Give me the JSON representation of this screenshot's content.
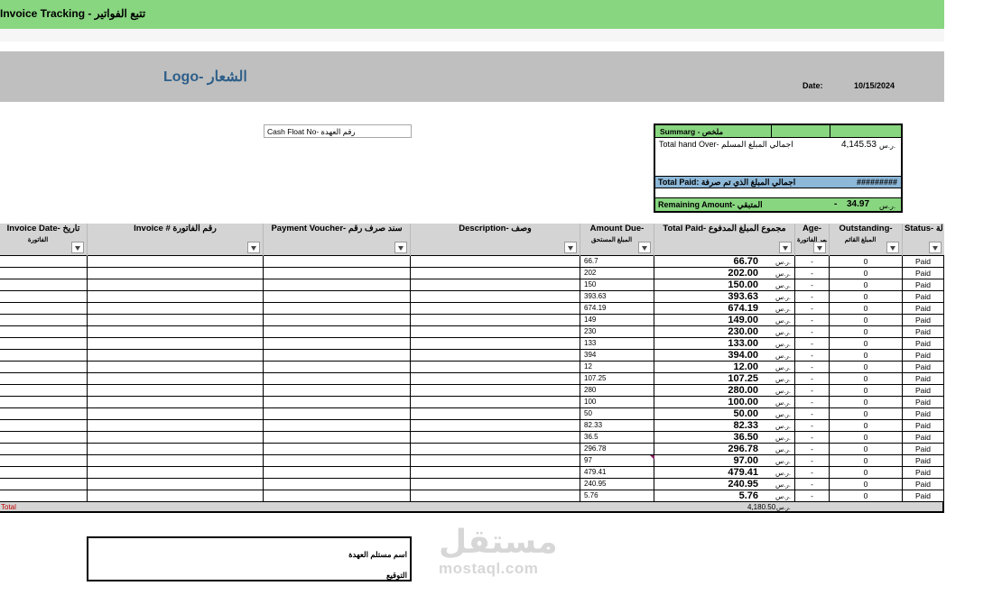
{
  "title": "Invoice Tracking - تتبع الفواتير",
  "logo": "Logo- الشعار",
  "date": {
    "label": "Date:",
    "value": "10/15/2024"
  },
  "cash_float": "Cash Float No- رقم العهدة",
  "summary": {
    "header": "Summarg - ملخص",
    "total_handover_label": "Total hand Over- اجمالي المبلغ المسلم",
    "total_handover_value": "4,145.53",
    "total_handover_currency": "ر.س.",
    "total_paid_label": "Total Paid: اجمالي المبلغ الذي تم صرفة",
    "total_paid_value": "#########",
    "remaining_label": "Remaining Amount- المتبقي",
    "remaining_sign": "-",
    "remaining_value": "34.97",
    "remaining_currency": "ر.س."
  },
  "columns": [
    {
      "title": "Invoice Date- تاريخ",
      "sub": "الفاتورة"
    },
    {
      "title": "Invoice # رقم الفاتورة",
      "sub": ""
    },
    {
      "title": "Payment Voucher- سند صرف رقم",
      "sub": ""
    },
    {
      "title": "Description- وصف",
      "sub": ""
    },
    {
      "title": "Amount Due-",
      "sub": "المبلغ المستحق"
    },
    {
      "title": "Total Paid- مجموع المبلغ المدفوع",
      "sub": ""
    },
    {
      "title": "Age-",
      "sub": "عمر الفاتورة"
    },
    {
      "title": "Outstanding-",
      "sub": "المبلغ القائم"
    },
    {
      "title": "Status- الحالة",
      "sub": ""
    }
  ],
  "currency": "ر.س.",
  "rows": [
    {
      "due": "66.7",
      "paid": "66.70",
      "age": "-",
      "outstanding": "0",
      "status": "Paid"
    },
    {
      "due": "202",
      "paid": "202.00",
      "age": "-",
      "outstanding": "0",
      "status": "Paid"
    },
    {
      "due": "150",
      "paid": "150.00",
      "age": "-",
      "outstanding": "0",
      "status": "Paid"
    },
    {
      "due": "393.63",
      "paid": "393.63",
      "age": "-",
      "outstanding": "0",
      "status": "Paid"
    },
    {
      "due": "674.19",
      "paid": "674.19",
      "age": "-",
      "outstanding": "0",
      "status": "Paid"
    },
    {
      "due": "149",
      "paid": "149.00",
      "age": "-",
      "outstanding": "0",
      "status": "Paid"
    },
    {
      "due": "230",
      "paid": "230.00",
      "age": "-",
      "outstanding": "0",
      "status": "Paid"
    },
    {
      "due": "133",
      "paid": "133.00",
      "age": "-",
      "outstanding": "0",
      "status": "Paid"
    },
    {
      "due": "394",
      "paid": "394.00",
      "age": "-",
      "outstanding": "0",
      "status": "Paid"
    },
    {
      "due": "12",
      "paid": "12.00",
      "age": "-",
      "outstanding": "0",
      "status": "Paid"
    },
    {
      "due": "107.25",
      "paid": "107.25",
      "age": "-",
      "outstanding": "0",
      "status": "Paid"
    },
    {
      "due": "280",
      "paid": "280.00",
      "age": "-",
      "outstanding": "0",
      "status": "Paid"
    },
    {
      "due": "100",
      "paid": "100.00",
      "age": "-",
      "outstanding": "0",
      "status": "Paid"
    },
    {
      "due": "50",
      "paid": "50.00",
      "age": "-",
      "outstanding": "0",
      "status": "Paid"
    },
    {
      "due": "82.33",
      "paid": "82.33",
      "age": "-",
      "outstanding": "0",
      "status": "Paid"
    },
    {
      "due": "36.5",
      "paid": "36.50",
      "age": "-",
      "outstanding": "0",
      "status": "Paid"
    },
    {
      "due": "296.78",
      "paid": "296.78",
      "age": "-",
      "outstanding": "0",
      "status": "Paid"
    },
    {
      "due": "97",
      "paid": "97.00",
      "age": "-",
      "outstanding": "0",
      "status": "Paid"
    },
    {
      "due": "479.41",
      "paid": "479.41",
      "age": "-",
      "outstanding": "0",
      "status": "Paid"
    },
    {
      "due": "240.95",
      "paid": "240.95",
      "age": "-",
      "outstanding": "0",
      "status": "Paid"
    },
    {
      "due": "5.76",
      "paid": "5.76",
      "age": "-",
      "outstanding": "0",
      "status": "Paid"
    }
  ],
  "total": {
    "label": "Total",
    "value": "4,180.50",
    "currency": "ر.س."
  },
  "signature": {
    "receiver": "اسم مستلم العهدة",
    "sign": "التوقيع"
  },
  "watermark": {
    "arabic": "مستقل",
    "latin": "mostaql.com"
  }
}
